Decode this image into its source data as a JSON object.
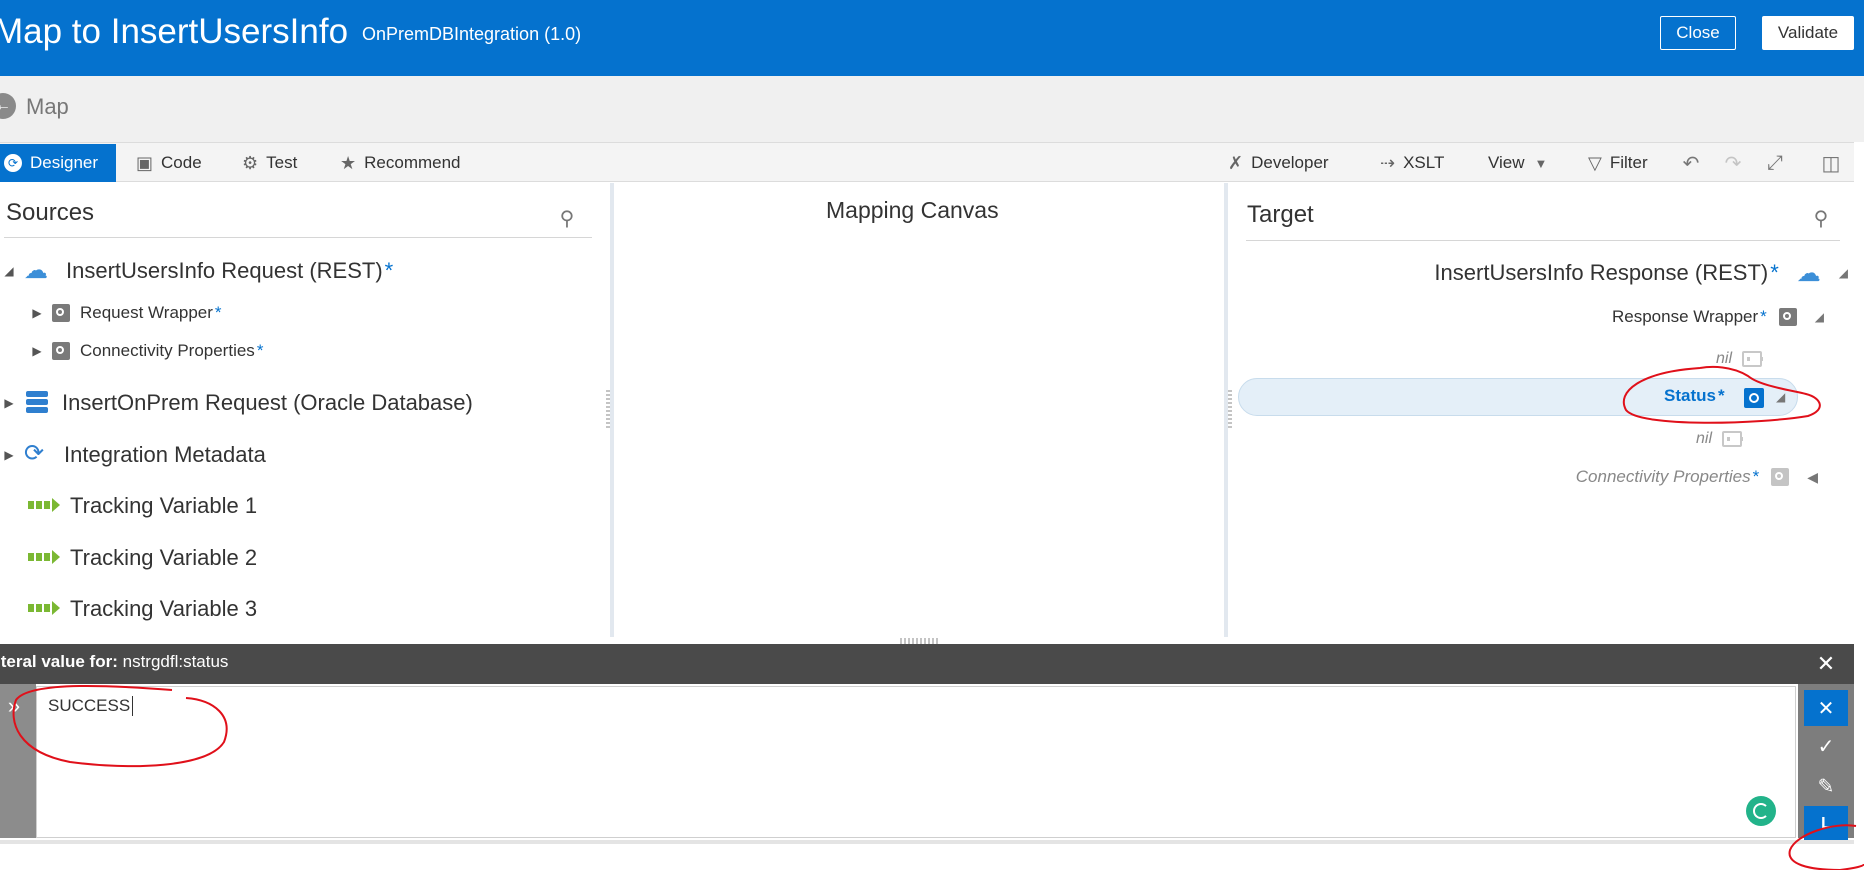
{
  "header": {
    "title": "Map to InsertUsersInfo",
    "subtitle": "OnPremDBIntegration (1.0)",
    "close_label": "Close",
    "validate_label": "Validate"
  },
  "breadcrumb": {
    "label": "Map"
  },
  "tabs": [
    {
      "label": "Designer",
      "icon": "designer-icon",
      "active": true
    },
    {
      "label": "Code",
      "icon": "code-icon"
    },
    {
      "label": "Test",
      "icon": "gear-icon"
    },
    {
      "label": "Recommend",
      "icon": "star-icon"
    }
  ],
  "tools": [
    {
      "label": "Developer",
      "icon": "wrench-icon"
    },
    {
      "label": "XSLT",
      "icon": "xslt-icon"
    },
    {
      "label": "View",
      "icon": "chevron-down-icon"
    },
    {
      "label": "Filter",
      "icon": "filter-icon"
    }
  ],
  "sources": {
    "title": "Sources",
    "items": [
      {
        "label": "InsertUsersInfo Request (REST)",
        "star": "*"
      },
      {
        "label": "Request Wrapper",
        "star": "*"
      },
      {
        "label": "Connectivity Properties",
        "star": "*"
      },
      {
        "label": "InsertOnPrem Request (Oracle Database)"
      },
      {
        "label": "Integration Metadata"
      },
      {
        "label": "Tracking Variable 1"
      },
      {
        "label": "Tracking Variable 2"
      },
      {
        "label": "Tracking Variable 3"
      }
    ]
  },
  "canvas": {
    "title": "Mapping Canvas"
  },
  "target": {
    "title": "Target",
    "items": [
      {
        "label": "InsertUsersInfo Response (REST)",
        "star": "*"
      },
      {
        "label": "Response Wrapper",
        "star": "*"
      },
      {
        "label": "nil"
      },
      {
        "label": "Status",
        "star": "*"
      },
      {
        "label": "nil"
      },
      {
        "label": "Connectivity Properties",
        "star": "*"
      }
    ]
  },
  "literal": {
    "prefix": "iteral value for: ",
    "field": "nstrgdfl:status",
    "value": "SUCCESS",
    "mode_label": "L"
  },
  "colors": {
    "brand": "#0572ce",
    "annotation": "#e0101a"
  }
}
